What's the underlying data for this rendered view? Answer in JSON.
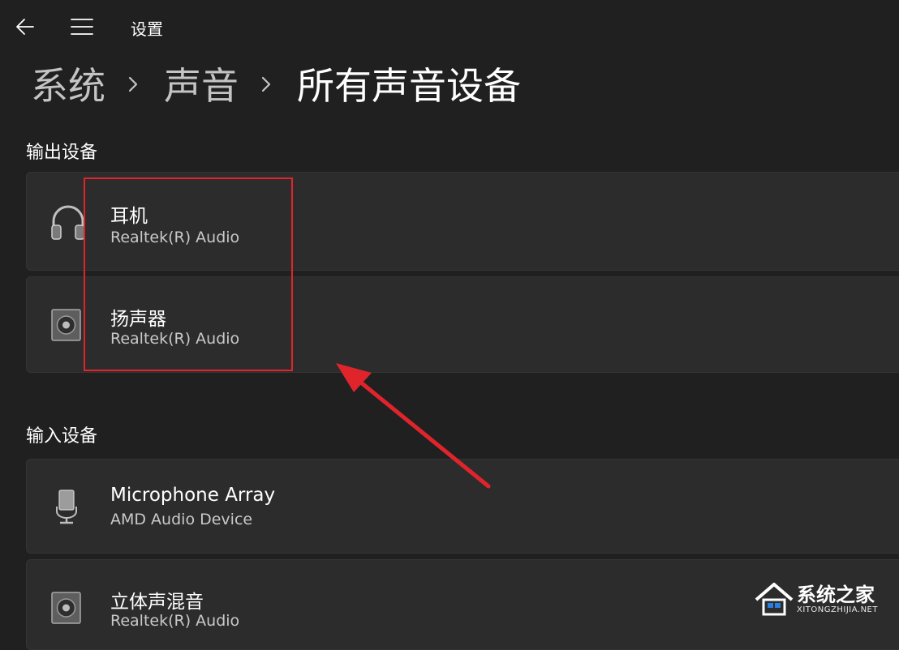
{
  "app": {
    "title": "设置"
  },
  "breadcrumb": {
    "items": [
      "系统",
      "声音",
      "所有声音设备"
    ]
  },
  "output": {
    "title": "输出设备",
    "devices": [
      {
        "name": "耳机",
        "subtitle": "Realtek(R) Audio",
        "icon": "headphones-icon"
      },
      {
        "name": "扬声器",
        "subtitle": "Realtek(R) Audio",
        "icon": "speaker-icon"
      }
    ]
  },
  "input": {
    "title": "输入设备",
    "devices": [
      {
        "name": "Microphone Array",
        "subtitle": "AMD Audio Device",
        "icon": "microphone-icon"
      },
      {
        "name": "立体声混音",
        "subtitle": "Realtek(R) Audio",
        "icon": "speaker-icon"
      }
    ]
  },
  "watermark": {
    "name": "系统之家",
    "url": "XITONGZHIJIA.NET"
  },
  "colors": {
    "background": "#202020",
    "card": "#2c2c2c",
    "highlight": "#e0242c"
  }
}
